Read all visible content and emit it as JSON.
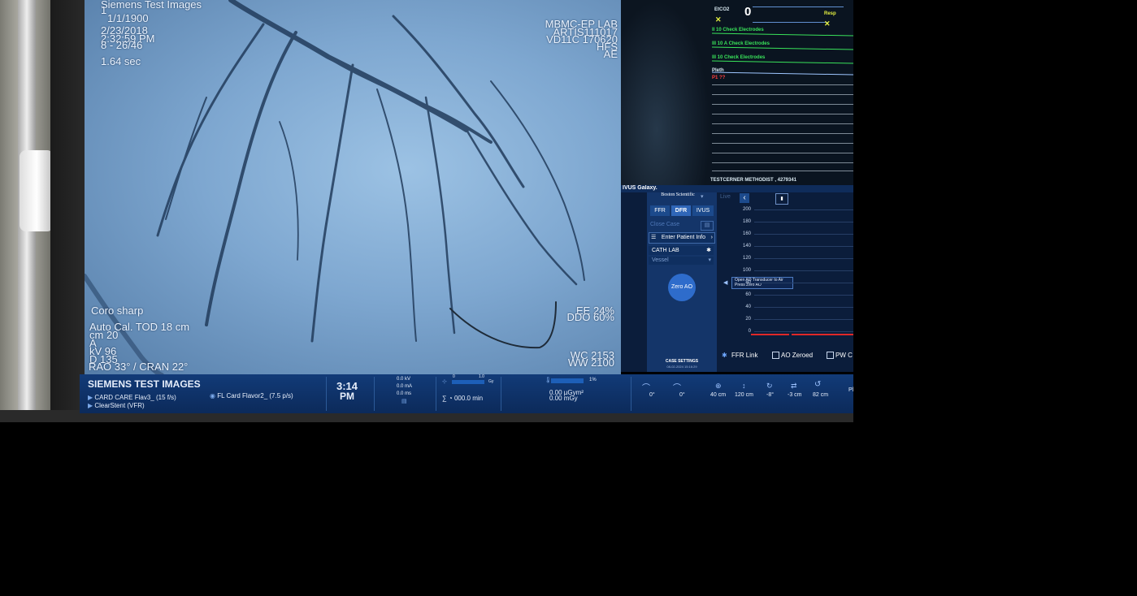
{
  "angio": {
    "header_top": "Siemens Test Images",
    "line1": "1",
    "date_birth": "1/1/1900",
    "date": "2/23/2018",
    "time": "2:32:59 PM",
    "series": "8 - 26/46",
    "duration": "1.64 sec",
    "site": "MBMC-EP LAB",
    "system": "ARTIS111017",
    "version": "VD11C 170620",
    "orientation": "HFS",
    "ae": "AE",
    "filter": "Coro sharp",
    "auto_cal": "Auto Cal. TOD 18 cm",
    "field": "cm 20",
    "plane": "A",
    "kv": "kV 96",
    "d": "D 135",
    "angle": "RAO 33° / CRAN 22°",
    "ee": "EE 24%",
    "ddo": "DDO 60%",
    "wc": "WC 2153",
    "ww": "WW 2100"
  },
  "monitor": {
    "etco2": "EtCO2",
    "etco2_value": "0",
    "resp": "Resp",
    "lead1": "II 10   Check Electrodes",
    "lead2": "III 10  A  Check Electrodes",
    "lead3": "III 10   Check Electrodes",
    "pleth": "Pleth",
    "art": "P1 ??",
    "patient": "TESTCERNER METHODIST , 4279341"
  },
  "ivus": {
    "title": "IVUS Galaxy.",
    "brand": "Boston Scientific",
    "live": "Live",
    "tabs": [
      "FFR",
      "DFR",
      "IVUS"
    ],
    "close_case": "Close Case",
    "enter_patient": "Enter Patient Info",
    "cath_lab": "CATH LAB",
    "vessel_placeholder": "Vessel",
    "zero_ao": "Zero AO",
    "instruction_line1": "Open AO Transducer to Air",
    "instruction_line2": "Press Zero AO",
    "y_ticks": [
      "200",
      "180",
      "160",
      "140",
      "120",
      "100",
      "80",
      "60",
      "40",
      "20",
      "0"
    ],
    "case_settings": "CASE SETTINGS",
    "case_date": "08-02-2024 15:16:29",
    "ffr_link": "FFR Link",
    "ao_zeroed": "AO Zeroed",
    "pw": "PW C"
  },
  "status": {
    "title": "SIEMENS TEST IMAGES",
    "program1": "CARD CARE Flav3_ (15 f/s)",
    "program2": "ClearStent (VFR)",
    "fluoro_program": "FL Card Flavor2_ (7.5 p/s)",
    "clock_time": "3:14",
    "clock_ampm": "PM",
    "kv": "0.0 kV",
    "ma": "0.0 mA",
    "ms": "0.0 ms",
    "scale_min": "0",
    "scale_max": "1.0",
    "gy_unit": "Gy",
    "fluoro_time": "000.0 min",
    "percent": "1%",
    "dose_area": "0.00 µGym²",
    "dose": "0.00 mGy",
    "angle1": "0°",
    "angle2": "0°",
    "zoom": "40 cm",
    "sid": "120 cm",
    "tilt": "-8°",
    "lat": "-3 cm",
    "height": "82 cm",
    "more": "Pl"
  }
}
